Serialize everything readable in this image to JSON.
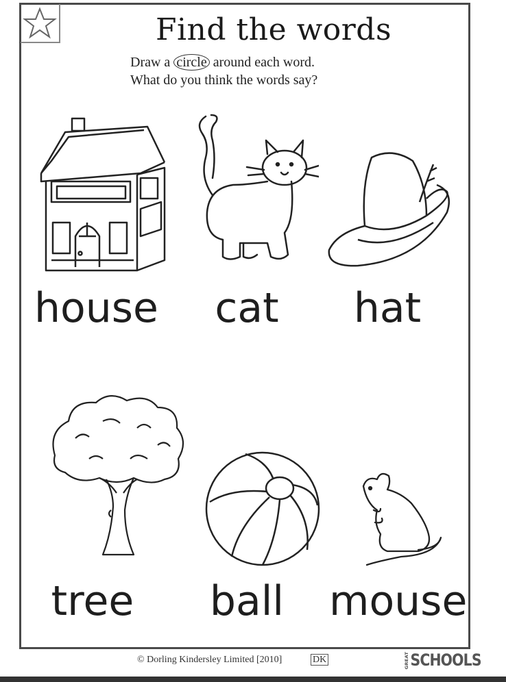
{
  "title": "Find the words",
  "instructions": {
    "line1_before": "Draw a",
    "line1_circled": "circle",
    "line1_after": "around each word.",
    "line2": "What do you think the words say?"
  },
  "words": [
    "house",
    "cat",
    "hat",
    "tree",
    "ball",
    "mouse"
  ],
  "icons": [
    "star-icon",
    "house-icon",
    "cat-icon",
    "hat-icon",
    "tree-icon",
    "ball-icon",
    "mouse-icon"
  ],
  "footer": {
    "copyright": "© Dorling Kindersley Limited [2010]",
    "publisher_mark": "DK",
    "brand_small": "GREAT",
    "brand": "SCHOOLS"
  }
}
